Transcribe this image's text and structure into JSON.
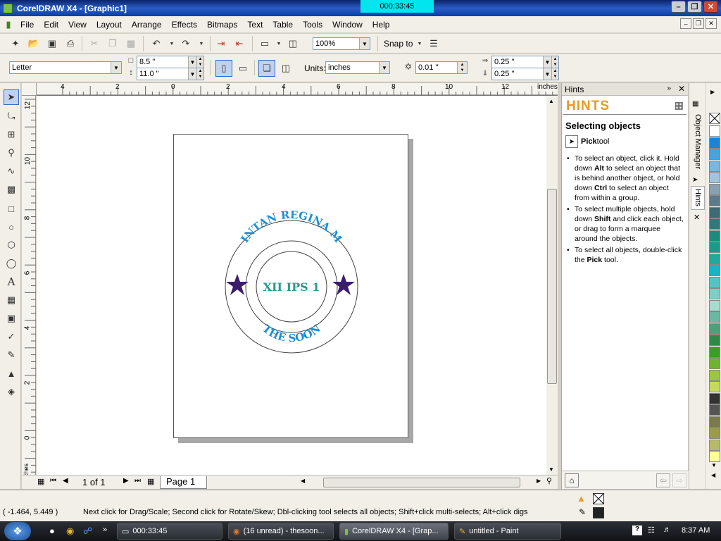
{
  "window": {
    "title": "CorelDRAW X4 - [Graphic1]",
    "timer": "000:33:45"
  },
  "menu": [
    "File",
    "Edit",
    "View",
    "Layout",
    "Arrange",
    "Effects",
    "Bitmaps",
    "Text",
    "Table",
    "Tools",
    "Window",
    "Help"
  ],
  "toolbar": {
    "zoom": "100%",
    "snap_to": "Snap to"
  },
  "property_bar": {
    "paper": "Letter",
    "width": "8.5 \"",
    "height": "11.0 \"",
    "units_label": "Units:",
    "units": "inches",
    "nudge": "0.01 \"",
    "dup_x": "0.25 \"",
    "dup_y": "0.25 \""
  },
  "ruler": {
    "h_labels": [
      "4",
      "2",
      "0",
      "2",
      "4",
      "6",
      "8",
      "10",
      "12"
    ],
    "h_unit": "inches",
    "v_labels": [
      "12",
      "10",
      "8",
      "6",
      "4",
      "2",
      "0"
    ],
    "v_unit": "inches"
  },
  "design": {
    "top_text": "INTAN REGINA M",
    "center_text": "XII IPS 1",
    "bottom_text": "THE SOON",
    "blue": "#1a8fd6",
    "teal": "#2a9a8f",
    "star": "#3b1d6e"
  },
  "pagebar": {
    "page_count": "1 of 1",
    "page_tab": "Page 1"
  },
  "hints": {
    "panel_title": "Hints",
    "heading": "HINTS",
    "subtitle": "Selecting objects",
    "tool_name": "Pick",
    "tool_suffix": " tool",
    "items": [
      [
        "To select an object, click it. Hold down ",
        "Alt",
        " to select an object that is behind another object, or hold down ",
        "Ctrl",
        " to select an object from within a group."
      ],
      [
        "To select multiple objects, hold down ",
        "Shift",
        " and click each object, or drag to form a marquee around the objects."
      ],
      [
        "To select all objects, double-click the ",
        "Pick",
        " tool."
      ]
    ]
  },
  "dockers": {
    "object_manager": "Object Manager",
    "hints": "Hints"
  },
  "palette": [
    "#ffffff",
    "#1c84d6",
    "#48a2e0",
    "#7ab6df",
    "#a4c4dc",
    "#8aa2b0",
    "#5e7a8a",
    "#3e6a74",
    "#2f7b7a",
    "#1f8a7e",
    "#1a9a8c",
    "#23a99a",
    "#17b3c9",
    "#55c3c6",
    "#7fcfc6",
    "#a7dccf",
    "#6bb8a2",
    "#4fa07a",
    "#2f8a4a",
    "#3f9a2a",
    "#6fb42f",
    "#9cc63f",
    "#c5d95f",
    "#333333",
    "#555555",
    "#7a7a4a",
    "#9a9a55",
    "#b9b96a",
    "#ffff99"
  ],
  "status": {
    "coords": "( -1.464, 5.449  )",
    "message": "Next click for Drag/Scale; Second click for Rotate/Skew; Dbl-clicking tool selects all objects; Shift+click multi-selects; Alt+click digs"
  },
  "taskbar": {
    "items": [
      "000:33:45",
      "(16 unread) - thesoon...",
      "CorelDRAW X4 - [Grap...",
      "untitled - Paint"
    ],
    "time": "8:37 AM"
  }
}
